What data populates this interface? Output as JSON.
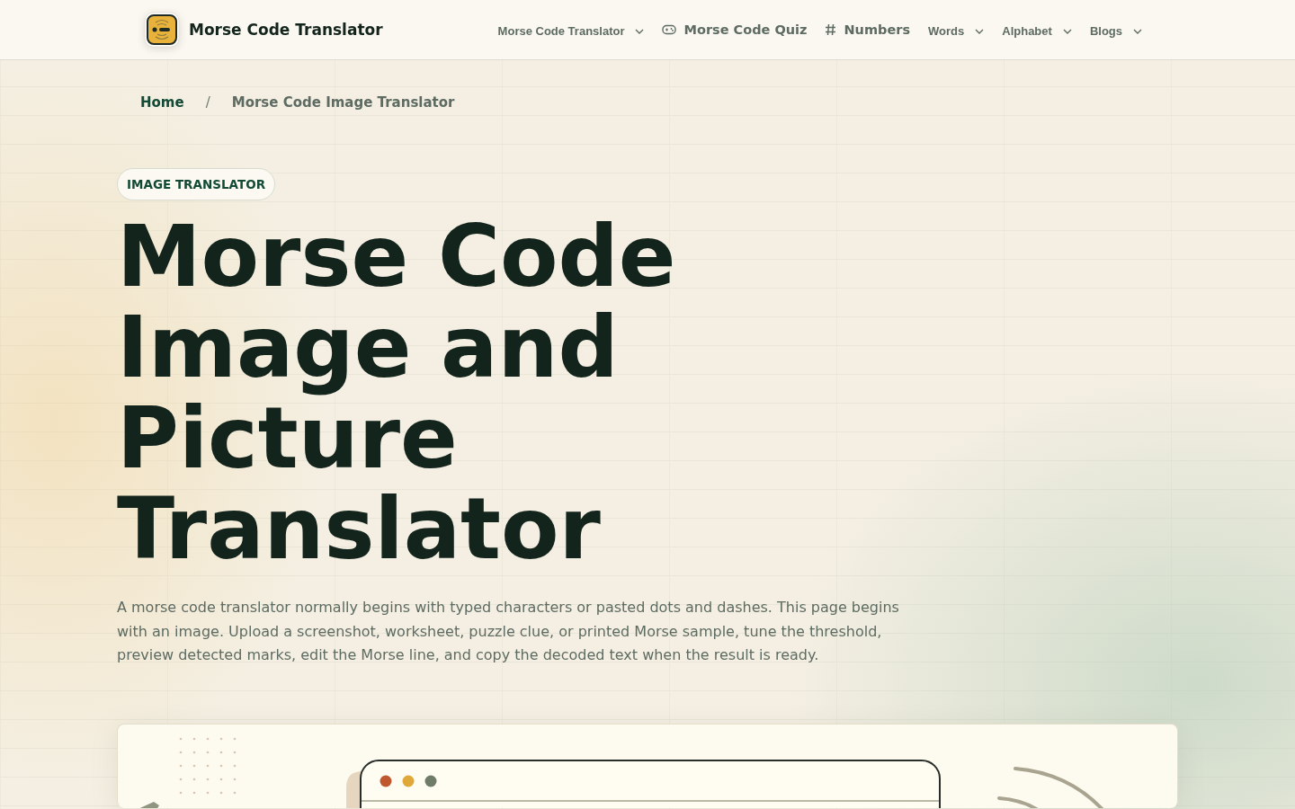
{
  "header": {
    "brand": "Morse Code Translator",
    "nav": [
      {
        "label": "Morse Code Translator",
        "kind": "dropdown"
      },
      {
        "label": "Morse Code Quiz",
        "kind": "game"
      },
      {
        "label": "Numbers",
        "kind": "hash"
      },
      {
        "label": "Words",
        "kind": "dropdown"
      },
      {
        "label": "Alphabet",
        "kind": "dropdown"
      },
      {
        "label": "Blogs",
        "kind": "dropdown"
      }
    ]
  },
  "breadcrumb_separator": "/",
  "breadcrumb": [
    {
      "label": "Home",
      "selected": false
    },
    {
      "label": "Morse Code Image Translator",
      "selected": true
    }
  ],
  "badge": "IMAGE TRANSLATOR",
  "title": "Morse Code Image and Picture Translator",
  "intro": "A morse code translator normally begins with typed characters or pasted dots and dashes. This page begins with an image. Upload a screenshot, worksheet, puzzle clue, or printed Morse sample, tune the threshold, preview detected marks, edit the Morse line, and copy the decoded text when the result is ready."
}
